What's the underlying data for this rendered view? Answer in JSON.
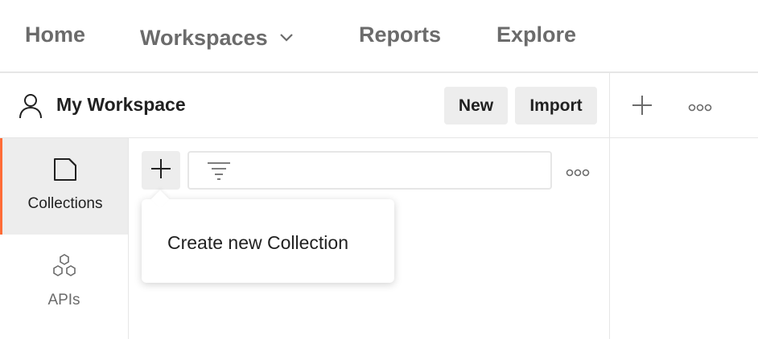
{
  "topnav": {
    "items": [
      {
        "label": "Home"
      },
      {
        "label": "Workspaces"
      },
      {
        "label": "Reports"
      },
      {
        "label": "Explore"
      }
    ],
    "workspaces_icon": "chevron-down-icon"
  },
  "workspace": {
    "title": "My Workspace",
    "user_icon": "user-icon",
    "new_label": "New",
    "import_label": "Import"
  },
  "right_header": {
    "plus_icon": "plus-icon",
    "more_icon": "more-options-icon"
  },
  "sidebar": {
    "items": [
      {
        "label": "Collections",
        "icon": "collection-icon",
        "active": true
      },
      {
        "label": "APIs",
        "icon": "apis-icon",
        "active": false
      }
    ]
  },
  "main": {
    "add_icon": "plus-icon",
    "filter_icon": "filter-icon",
    "more_icon": "more-options-icon"
  },
  "popup": {
    "text": "Create new Collection"
  },
  "colors": {
    "accent": "#ff6c37",
    "active_bg": "#ededed",
    "border": "#e6e6e6",
    "nav_text": "#6b6b6b"
  }
}
